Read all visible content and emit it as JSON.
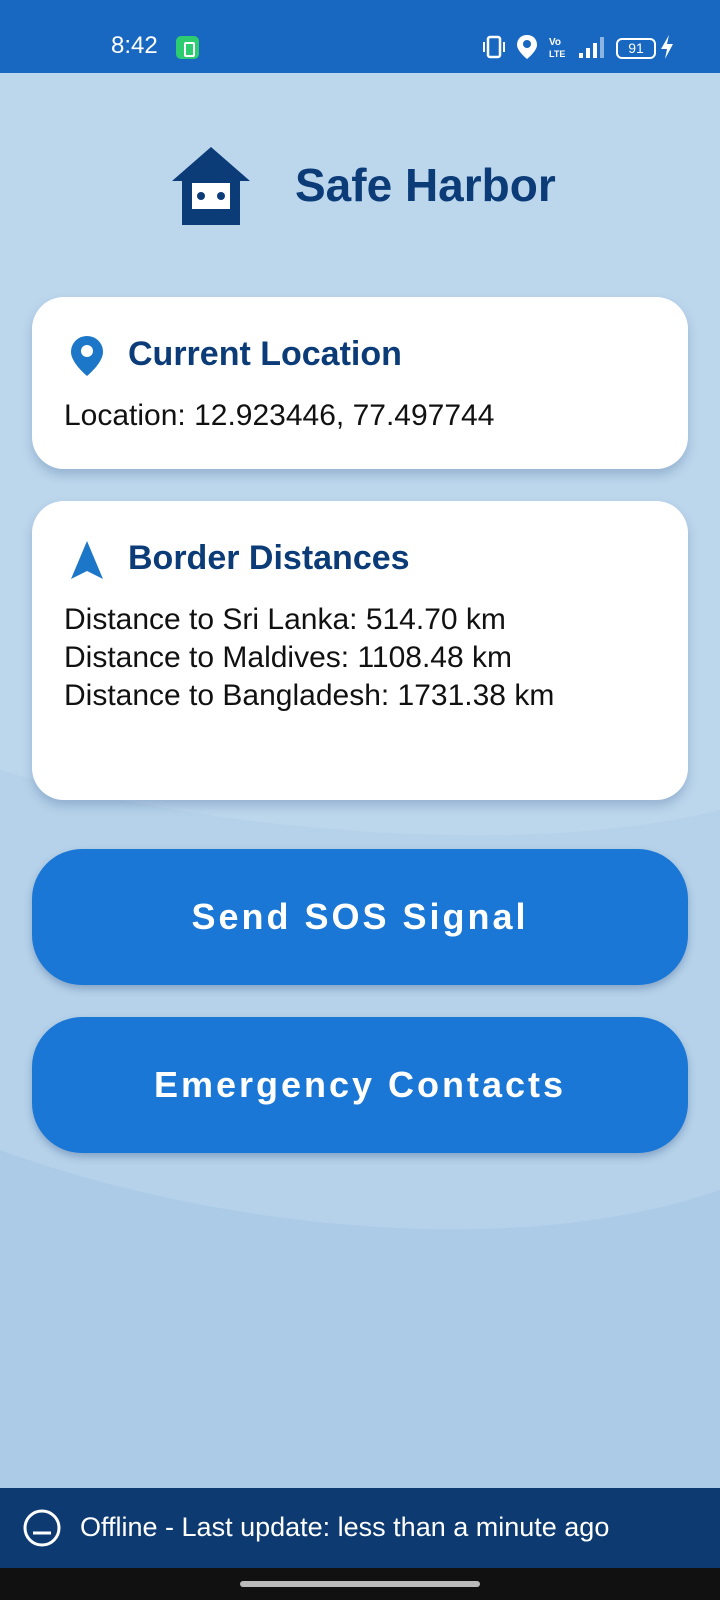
{
  "status_bar": {
    "time": "8:42",
    "battery_level": "91"
  },
  "header": {
    "title": "Safe Harbor"
  },
  "location_card": {
    "title": "Current Location",
    "text": "Location: 12.923446, 77.497744"
  },
  "border_card": {
    "title": "Border Distances",
    "lines": [
      "Distance to Sri Lanka: 514.70 km",
      "Distance to Maldives: 1108.48 km",
      "Distance to Bangladesh: 1731.38 km"
    ]
  },
  "buttons": {
    "sos_label": "Send SOS Signal",
    "contacts_label": "Emergency Contacts"
  },
  "offline_banner": {
    "text": "Offline - Last update: less than a minute ago"
  },
  "colors": {
    "status_bar": "#1868c2",
    "primary_button": "#1a77d6",
    "title_text": "#0c3c78",
    "offline_banner": "#0d3a70",
    "background": "#bcd6ec"
  },
  "icons": {
    "header": "home-icon",
    "location": "location-pin-icon",
    "border": "navigation-arrow-icon",
    "offline": "offline-status-icon"
  }
}
